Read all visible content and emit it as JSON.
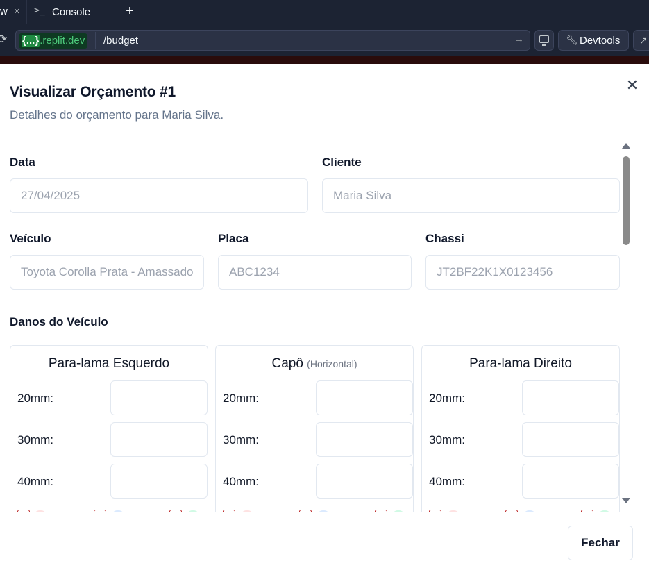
{
  "browser": {
    "tabs": [
      {
        "label": "w",
        "active": true
      },
      {
        "label": "Console",
        "active": false
      }
    ],
    "new_tab": "+",
    "url_host_brace": "{...}",
    "url_host_domain": ".replit.dev",
    "url_path": "/budget",
    "buttons": {
      "devtools": "Devtools"
    }
  },
  "dialog": {
    "title": "Visualizar Orçamento #1",
    "description": "Detalhes do orçamento para Maria Silva.",
    "fields": {
      "data": {
        "label": "Data",
        "value": "27/04/2025"
      },
      "cliente": {
        "label": "Cliente",
        "value": "Maria Silva"
      },
      "veiculo": {
        "label": "Veículo",
        "value": "Toyota Corolla Prata - Amassado"
      },
      "placa": {
        "label": "Placa",
        "value": "ABC1234"
      },
      "chassi": {
        "label": "Chassi",
        "value": "JT2BF22K1X0123456"
      }
    },
    "damage_section_title": "Danos do Veículo",
    "damage_cards": [
      {
        "title": "Para-lama Esquerdo",
        "subtitle": "",
        "rows": [
          "20mm:",
          "30mm:",
          "40mm:"
        ]
      },
      {
        "title": "Capô",
        "subtitle": "(Horizontal)",
        "rows": [
          "20mm:",
          "30mm:",
          "40mm:"
        ]
      },
      {
        "title": "Para-lama Direito",
        "subtitle": "",
        "rows": [
          "20mm:",
          "30mm:",
          "40mm:"
        ]
      }
    ],
    "close_button": "Fechar"
  },
  "colors": {
    "chrome_bg": "#1c2333",
    "border": "#e2e8f0",
    "muted_text": "#64748b",
    "placeholder_text": "#9ca3af"
  }
}
